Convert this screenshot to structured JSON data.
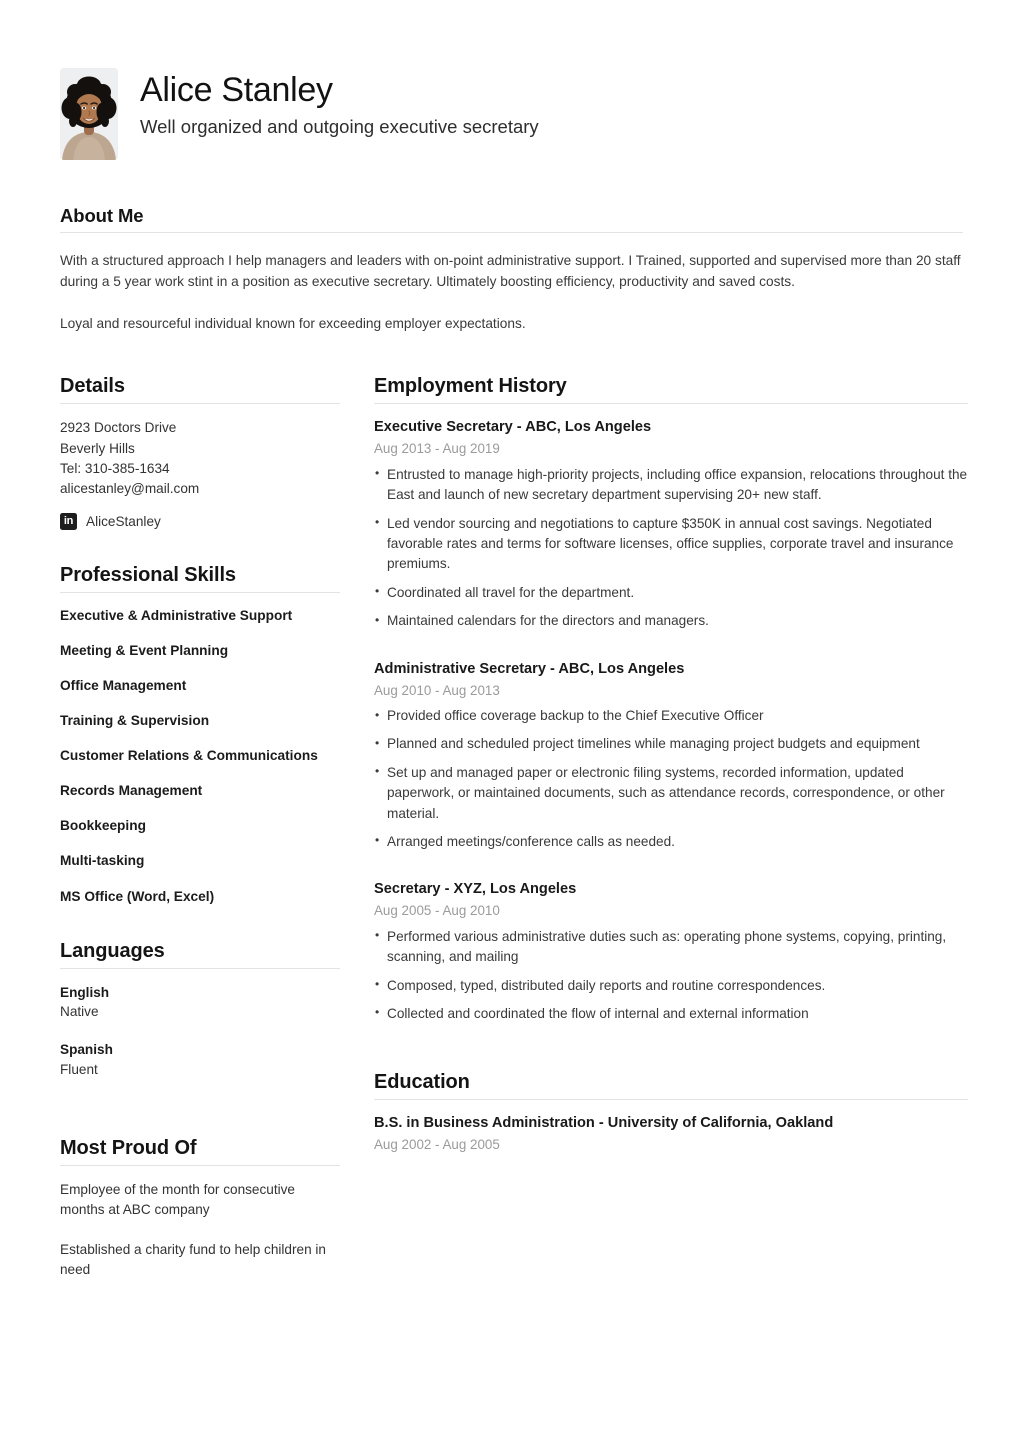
{
  "theme": {
    "page_background": "#ffffff",
    "heading_color": "#141414",
    "body_color": "#3a3a3a",
    "muted_color": "#9b9b9b",
    "rule_color": "#e3e3e3",
    "linkedin_badge_color": "#1d1d1d"
  },
  "header": {
    "name": "Alice Stanley",
    "tagline": "Well organized and outgoing executive secretary",
    "avatar_icon": "profile-photo"
  },
  "about": {
    "title": "About Me",
    "paragraphs": [
      "With a structured approach I help managers and leaders with on-point administrative support. I Trained, supported and supervised more than 20 staff during a 5 year work stint in a position as executive secretary. Ultimately boosting efficiency, productivity and saved costs.",
      "Loyal and resourceful individual known for exceeding employer expectations."
    ]
  },
  "details": {
    "title": "Details",
    "address_line1": "2923 Doctors Drive",
    "address_line2": "Beverly Hills",
    "phone": "Tel: 310-385-1634",
    "email": "alicestanley@mail.com",
    "social": {
      "icon": "linkedin-icon",
      "icon_label": "in",
      "handle": "AliceStanley"
    }
  },
  "skills": {
    "title": "Professional Skills",
    "items": [
      "Executive & Administrative Support",
      "Meeting & Event Planning",
      "Office Management",
      "Training & Supervision",
      "Customer Relations & Communications",
      "Records Management",
      "Bookkeeping",
      "Multi-tasking",
      "MS Office (Word, Excel)"
    ]
  },
  "languages": {
    "title": "Languages",
    "items": [
      {
        "name": "English",
        "level": "Native"
      },
      {
        "name": "Spanish",
        "level": "Fluent"
      }
    ]
  },
  "proud": {
    "title": "Most Proud Of",
    "items": [
      "Employee of the month for consecutive months at ABC company",
      "Established a charity fund to help children in need"
    ]
  },
  "employment": {
    "title": "Employment History",
    "jobs": [
      {
        "title": "Executive Secretary - ABC, Los Angeles",
        "dates": "Aug 2013 - Aug 2019",
        "bullets": [
          "Entrusted to manage high-priority projects, including office expansion, relocations throughout the East and launch of new secretary department supervising 20+ new staff.",
          "Led vendor sourcing and negotiations to capture $350K in annual cost savings. Negotiated favorable rates and terms for software licenses, office supplies, corporate travel and insurance premiums.",
          "Coordinated all travel for the department.",
          "Maintained calendars for the directors and managers."
        ]
      },
      {
        "title": "Administrative Secretary - ABC, Los Angeles",
        "dates": "Aug 2010 - Aug 2013",
        "bullets": [
          "Provided office coverage backup to the Chief Executive Officer",
          "Planned and scheduled project timelines while managing project budgets and equipment",
          "Set up and managed paper or electronic filing systems, recorded information, updated paperwork, or maintained documents, such as attendance records, correspondence, or other material.",
          "Arranged meetings/conference calls as needed."
        ]
      },
      {
        "title": "Secretary - XYZ, Los Angeles",
        "dates": "Aug 2005 - Aug 2010",
        "bullets": [
          "Performed various administrative duties such as: operating phone systems, copying, printing, scanning, and mailing",
          "Composed, typed, distributed daily reports and routine correspondences.",
          "Collected and coordinated the flow of internal and external information"
        ]
      }
    ]
  },
  "education": {
    "title": "Education",
    "entries": [
      {
        "title": "B.S. in Business Administration - University of California, Oakland",
        "dates": "Aug 2002 - Aug 2005"
      }
    ]
  }
}
